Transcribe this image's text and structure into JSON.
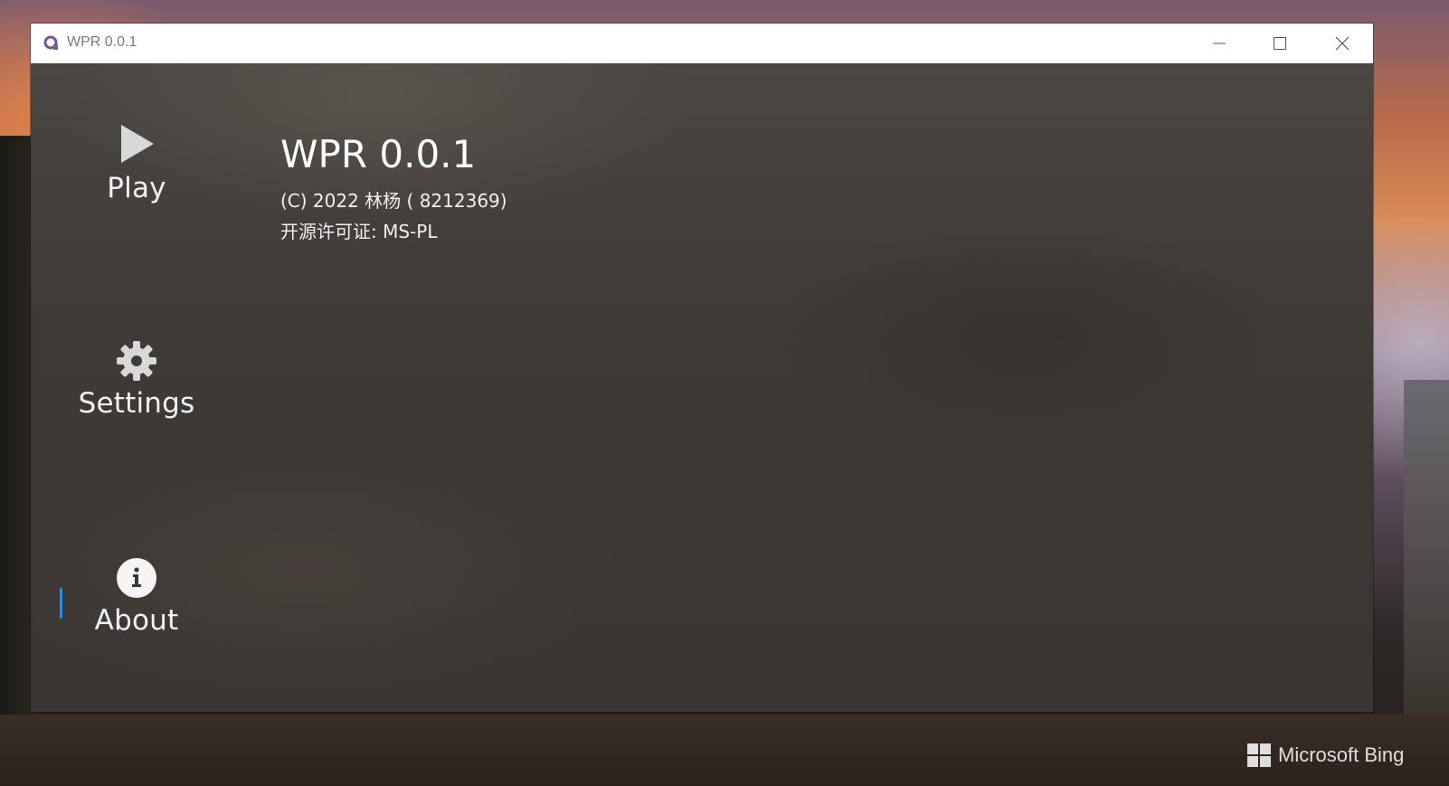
{
  "window": {
    "title": "WPR 0.0.1"
  },
  "nav": {
    "items": [
      {
        "label": "Play",
        "icon": "play-icon"
      },
      {
        "label": "Settings",
        "icon": "gear-icon"
      },
      {
        "label": "About",
        "icon": "info-icon",
        "selected": true
      }
    ]
  },
  "about": {
    "title": "WPR 0.0.1",
    "copyright": "(C) 2022 林杨 ( 8212369)",
    "license": "开源许可证: MS-PL"
  },
  "desktop": {
    "watermark": "Microsoft Bing"
  },
  "colors": {
    "accent": "#2f8ae0",
    "background": "#3c3834",
    "text": "#ffffff"
  }
}
